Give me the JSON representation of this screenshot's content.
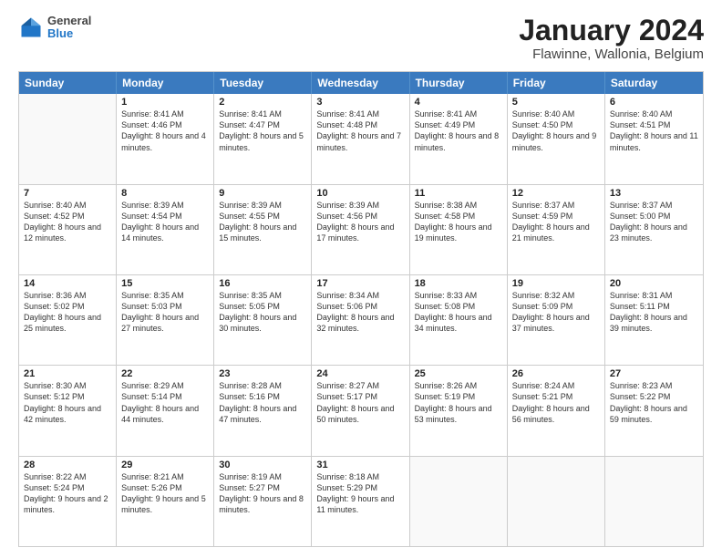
{
  "header": {
    "logo": {
      "general": "General",
      "blue": "Blue"
    },
    "title": "January 2024",
    "location": "Flawinne, Wallonia, Belgium"
  },
  "days": [
    "Sunday",
    "Monday",
    "Tuesday",
    "Wednesday",
    "Thursday",
    "Friday",
    "Saturday"
  ],
  "rows": [
    [
      {
        "day": "",
        "empty": true
      },
      {
        "day": "1",
        "sunrise": "Sunrise: 8:41 AM",
        "sunset": "Sunset: 4:46 PM",
        "daylight": "Daylight: 8 hours and 4 minutes."
      },
      {
        "day": "2",
        "sunrise": "Sunrise: 8:41 AM",
        "sunset": "Sunset: 4:47 PM",
        "daylight": "Daylight: 8 hours and 5 minutes."
      },
      {
        "day": "3",
        "sunrise": "Sunrise: 8:41 AM",
        "sunset": "Sunset: 4:48 PM",
        "daylight": "Daylight: 8 hours and 7 minutes."
      },
      {
        "day": "4",
        "sunrise": "Sunrise: 8:41 AM",
        "sunset": "Sunset: 4:49 PM",
        "daylight": "Daylight: 8 hours and 8 minutes."
      },
      {
        "day": "5",
        "sunrise": "Sunrise: 8:40 AM",
        "sunset": "Sunset: 4:50 PM",
        "daylight": "Daylight: 8 hours and 9 minutes."
      },
      {
        "day": "6",
        "sunrise": "Sunrise: 8:40 AM",
        "sunset": "Sunset: 4:51 PM",
        "daylight": "Daylight: 8 hours and 11 minutes."
      }
    ],
    [
      {
        "day": "7",
        "sunrise": "Sunrise: 8:40 AM",
        "sunset": "Sunset: 4:52 PM",
        "daylight": "Daylight: 8 hours and 12 minutes."
      },
      {
        "day": "8",
        "sunrise": "Sunrise: 8:39 AM",
        "sunset": "Sunset: 4:54 PM",
        "daylight": "Daylight: 8 hours and 14 minutes."
      },
      {
        "day": "9",
        "sunrise": "Sunrise: 8:39 AM",
        "sunset": "Sunset: 4:55 PM",
        "daylight": "Daylight: 8 hours and 15 minutes."
      },
      {
        "day": "10",
        "sunrise": "Sunrise: 8:39 AM",
        "sunset": "Sunset: 4:56 PM",
        "daylight": "Daylight: 8 hours and 17 minutes."
      },
      {
        "day": "11",
        "sunrise": "Sunrise: 8:38 AM",
        "sunset": "Sunset: 4:58 PM",
        "daylight": "Daylight: 8 hours and 19 minutes."
      },
      {
        "day": "12",
        "sunrise": "Sunrise: 8:37 AM",
        "sunset": "Sunset: 4:59 PM",
        "daylight": "Daylight: 8 hours and 21 minutes."
      },
      {
        "day": "13",
        "sunrise": "Sunrise: 8:37 AM",
        "sunset": "Sunset: 5:00 PM",
        "daylight": "Daylight: 8 hours and 23 minutes."
      }
    ],
    [
      {
        "day": "14",
        "sunrise": "Sunrise: 8:36 AM",
        "sunset": "Sunset: 5:02 PM",
        "daylight": "Daylight: 8 hours and 25 minutes."
      },
      {
        "day": "15",
        "sunrise": "Sunrise: 8:35 AM",
        "sunset": "Sunset: 5:03 PM",
        "daylight": "Daylight: 8 hours and 27 minutes."
      },
      {
        "day": "16",
        "sunrise": "Sunrise: 8:35 AM",
        "sunset": "Sunset: 5:05 PM",
        "daylight": "Daylight: 8 hours and 30 minutes."
      },
      {
        "day": "17",
        "sunrise": "Sunrise: 8:34 AM",
        "sunset": "Sunset: 5:06 PM",
        "daylight": "Daylight: 8 hours and 32 minutes."
      },
      {
        "day": "18",
        "sunrise": "Sunrise: 8:33 AM",
        "sunset": "Sunset: 5:08 PM",
        "daylight": "Daylight: 8 hours and 34 minutes."
      },
      {
        "day": "19",
        "sunrise": "Sunrise: 8:32 AM",
        "sunset": "Sunset: 5:09 PM",
        "daylight": "Daylight: 8 hours and 37 minutes."
      },
      {
        "day": "20",
        "sunrise": "Sunrise: 8:31 AM",
        "sunset": "Sunset: 5:11 PM",
        "daylight": "Daylight: 8 hours and 39 minutes."
      }
    ],
    [
      {
        "day": "21",
        "sunrise": "Sunrise: 8:30 AM",
        "sunset": "Sunset: 5:12 PM",
        "daylight": "Daylight: 8 hours and 42 minutes."
      },
      {
        "day": "22",
        "sunrise": "Sunrise: 8:29 AM",
        "sunset": "Sunset: 5:14 PM",
        "daylight": "Daylight: 8 hours and 44 minutes."
      },
      {
        "day": "23",
        "sunrise": "Sunrise: 8:28 AM",
        "sunset": "Sunset: 5:16 PM",
        "daylight": "Daylight: 8 hours and 47 minutes."
      },
      {
        "day": "24",
        "sunrise": "Sunrise: 8:27 AM",
        "sunset": "Sunset: 5:17 PM",
        "daylight": "Daylight: 8 hours and 50 minutes."
      },
      {
        "day": "25",
        "sunrise": "Sunrise: 8:26 AM",
        "sunset": "Sunset: 5:19 PM",
        "daylight": "Daylight: 8 hours and 53 minutes."
      },
      {
        "day": "26",
        "sunrise": "Sunrise: 8:24 AM",
        "sunset": "Sunset: 5:21 PM",
        "daylight": "Daylight: 8 hours and 56 minutes."
      },
      {
        "day": "27",
        "sunrise": "Sunrise: 8:23 AM",
        "sunset": "Sunset: 5:22 PM",
        "daylight": "Daylight: 8 hours and 59 minutes."
      }
    ],
    [
      {
        "day": "28",
        "sunrise": "Sunrise: 8:22 AM",
        "sunset": "Sunset: 5:24 PM",
        "daylight": "Daylight: 9 hours and 2 minutes."
      },
      {
        "day": "29",
        "sunrise": "Sunrise: 8:21 AM",
        "sunset": "Sunset: 5:26 PM",
        "daylight": "Daylight: 9 hours and 5 minutes."
      },
      {
        "day": "30",
        "sunrise": "Sunrise: 8:19 AM",
        "sunset": "Sunset: 5:27 PM",
        "daylight": "Daylight: 9 hours and 8 minutes."
      },
      {
        "day": "31",
        "sunrise": "Sunrise: 8:18 AM",
        "sunset": "Sunset: 5:29 PM",
        "daylight": "Daylight: 9 hours and 11 minutes."
      },
      {
        "day": "",
        "empty": true
      },
      {
        "day": "",
        "empty": true
      },
      {
        "day": "",
        "empty": true
      }
    ]
  ]
}
